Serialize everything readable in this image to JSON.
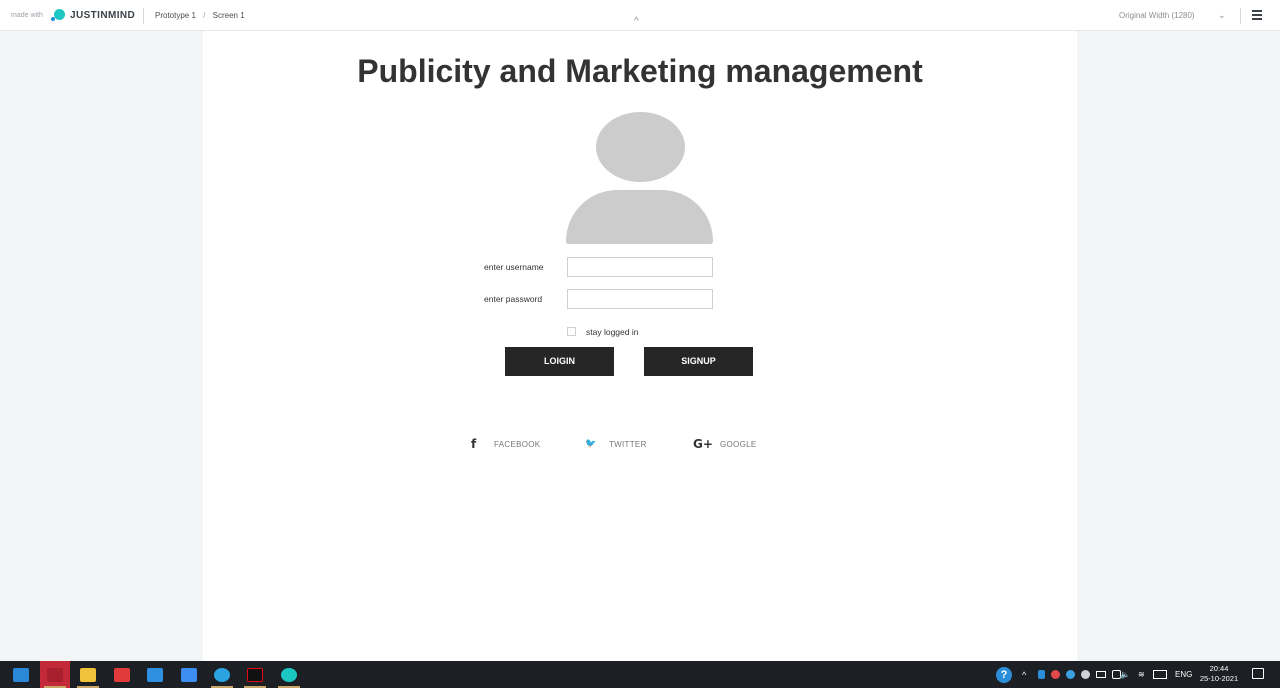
{
  "topbar": {
    "made_with": "made with",
    "brand": "JUSTINMIND",
    "breadcrumb_prototype": "Prototype 1",
    "breadcrumb_sep": "/",
    "breadcrumb_screen": "Screen 1",
    "collapse_caret": "^",
    "width_option": "Original Width (1280)",
    "width_chevron": "⌄"
  },
  "login": {
    "title": "Publicity and Marketing management",
    "username_label": "enter username",
    "username_value": "",
    "password_label": "enter password",
    "password_value": "",
    "stay_logged_in_label": "stay logged in",
    "stay_logged_in_checked": false,
    "login_button": "LOIGIN",
    "signup_button": "SIGNUP"
  },
  "social": [
    {
      "icon": "facebook-icon",
      "glyph": "f",
      "label": "FACEBOOK"
    },
    {
      "icon": "twitter-icon",
      "glyph": "🐦",
      "label": "TWITTER"
    },
    {
      "icon": "google-plus-icon",
      "glyph": "G+",
      "label": "GOOGLE"
    }
  ],
  "taskbar": {
    "apps": [
      {
        "name": "mail",
        "color": "#2b88d8"
      },
      {
        "name": "red-app",
        "color": "#c4293a"
      },
      {
        "name": "file-explorer",
        "color": "#f0c23b"
      },
      {
        "name": "vivaldi",
        "color": "#e23b3b"
      },
      {
        "name": "vscode",
        "color": "#2f8fe0"
      },
      {
        "name": "todo",
        "color": "#3c8ef0"
      },
      {
        "name": "telegram",
        "color": "#2aa3e0"
      },
      {
        "name": "netflix",
        "color": "#e50914"
      },
      {
        "name": "justinmind",
        "color": "#1cc6c3"
      }
    ],
    "language": "ENG",
    "time": "20:44",
    "date": "25-10-2021"
  },
  "colors": {
    "accent": "#1cc6c3",
    "button_bg": "#262626",
    "avatar": "#cccccc",
    "page_bg": "#f4f5f7"
  }
}
